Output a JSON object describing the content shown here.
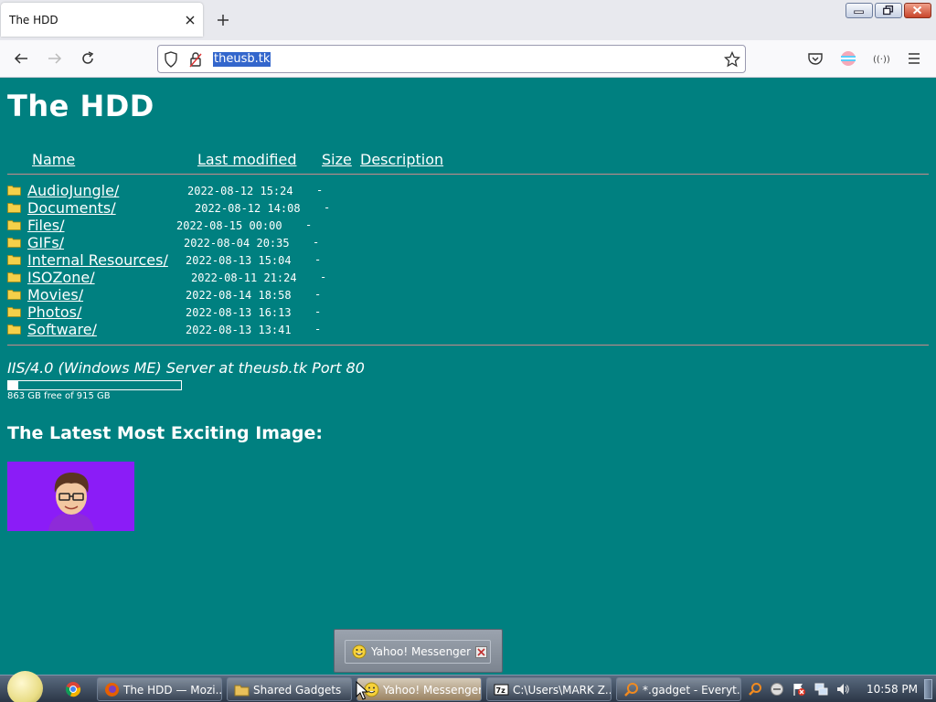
{
  "browser": {
    "tab_title": "The HDD",
    "url": "theusb.tk"
  },
  "page": {
    "heading": "The HDD",
    "columns": {
      "name": "Name",
      "last_modified": "Last modified",
      "size": "Size",
      "description": "Description"
    },
    "rows": [
      {
        "name": "AudioJungle/",
        "modified": "2022-08-12 15:24",
        "size": "-"
      },
      {
        "name": "Documents/",
        "modified": "2022-08-12 14:08",
        "size": "-"
      },
      {
        "name": "Files/",
        "modified": "2022-08-15 00:00",
        "size": "-"
      },
      {
        "name": "GIFs/",
        "modified": "2022-08-04 20:35",
        "size": "-"
      },
      {
        "name": "Internal Resources/",
        "modified": "2022-08-13 15:04",
        "size": "-"
      },
      {
        "name": "ISOZone/",
        "modified": "2022-08-11 21:24",
        "size": "-"
      },
      {
        "name": "Movies/",
        "modified": "2022-08-14 18:58",
        "size": "-"
      },
      {
        "name": "Photos/",
        "modified": "2022-08-13 16:13",
        "size": "-"
      },
      {
        "name": "Software/",
        "modified": "2022-08-13 13:41",
        "size": "-"
      }
    ],
    "server_signature": "IIS/4.0 (Windows ME) Server at theusb.tk Port 80",
    "disk": {
      "used_fraction": 0.057,
      "label": "863 GB free of 915 GB"
    },
    "latest_heading": "The Latest Most Exciting Image:"
  },
  "notification": {
    "text": "Yahoo! Messenger"
  },
  "taskbar": {
    "tasks": [
      {
        "label": "The HDD — Mozi..."
      },
      {
        "label": "Shared Gadgets"
      },
      {
        "label": "Yahoo! Messenger"
      },
      {
        "label": "C:\\Users\\MARK Z..."
      },
      {
        "label": "*.gadget - Everyt..."
      }
    ],
    "clock": "10:58 PM"
  },
  "colors": {
    "page_bg": "#008080",
    "image_bg": "#8b1cf7",
    "url_highlight": "#3366cc"
  }
}
